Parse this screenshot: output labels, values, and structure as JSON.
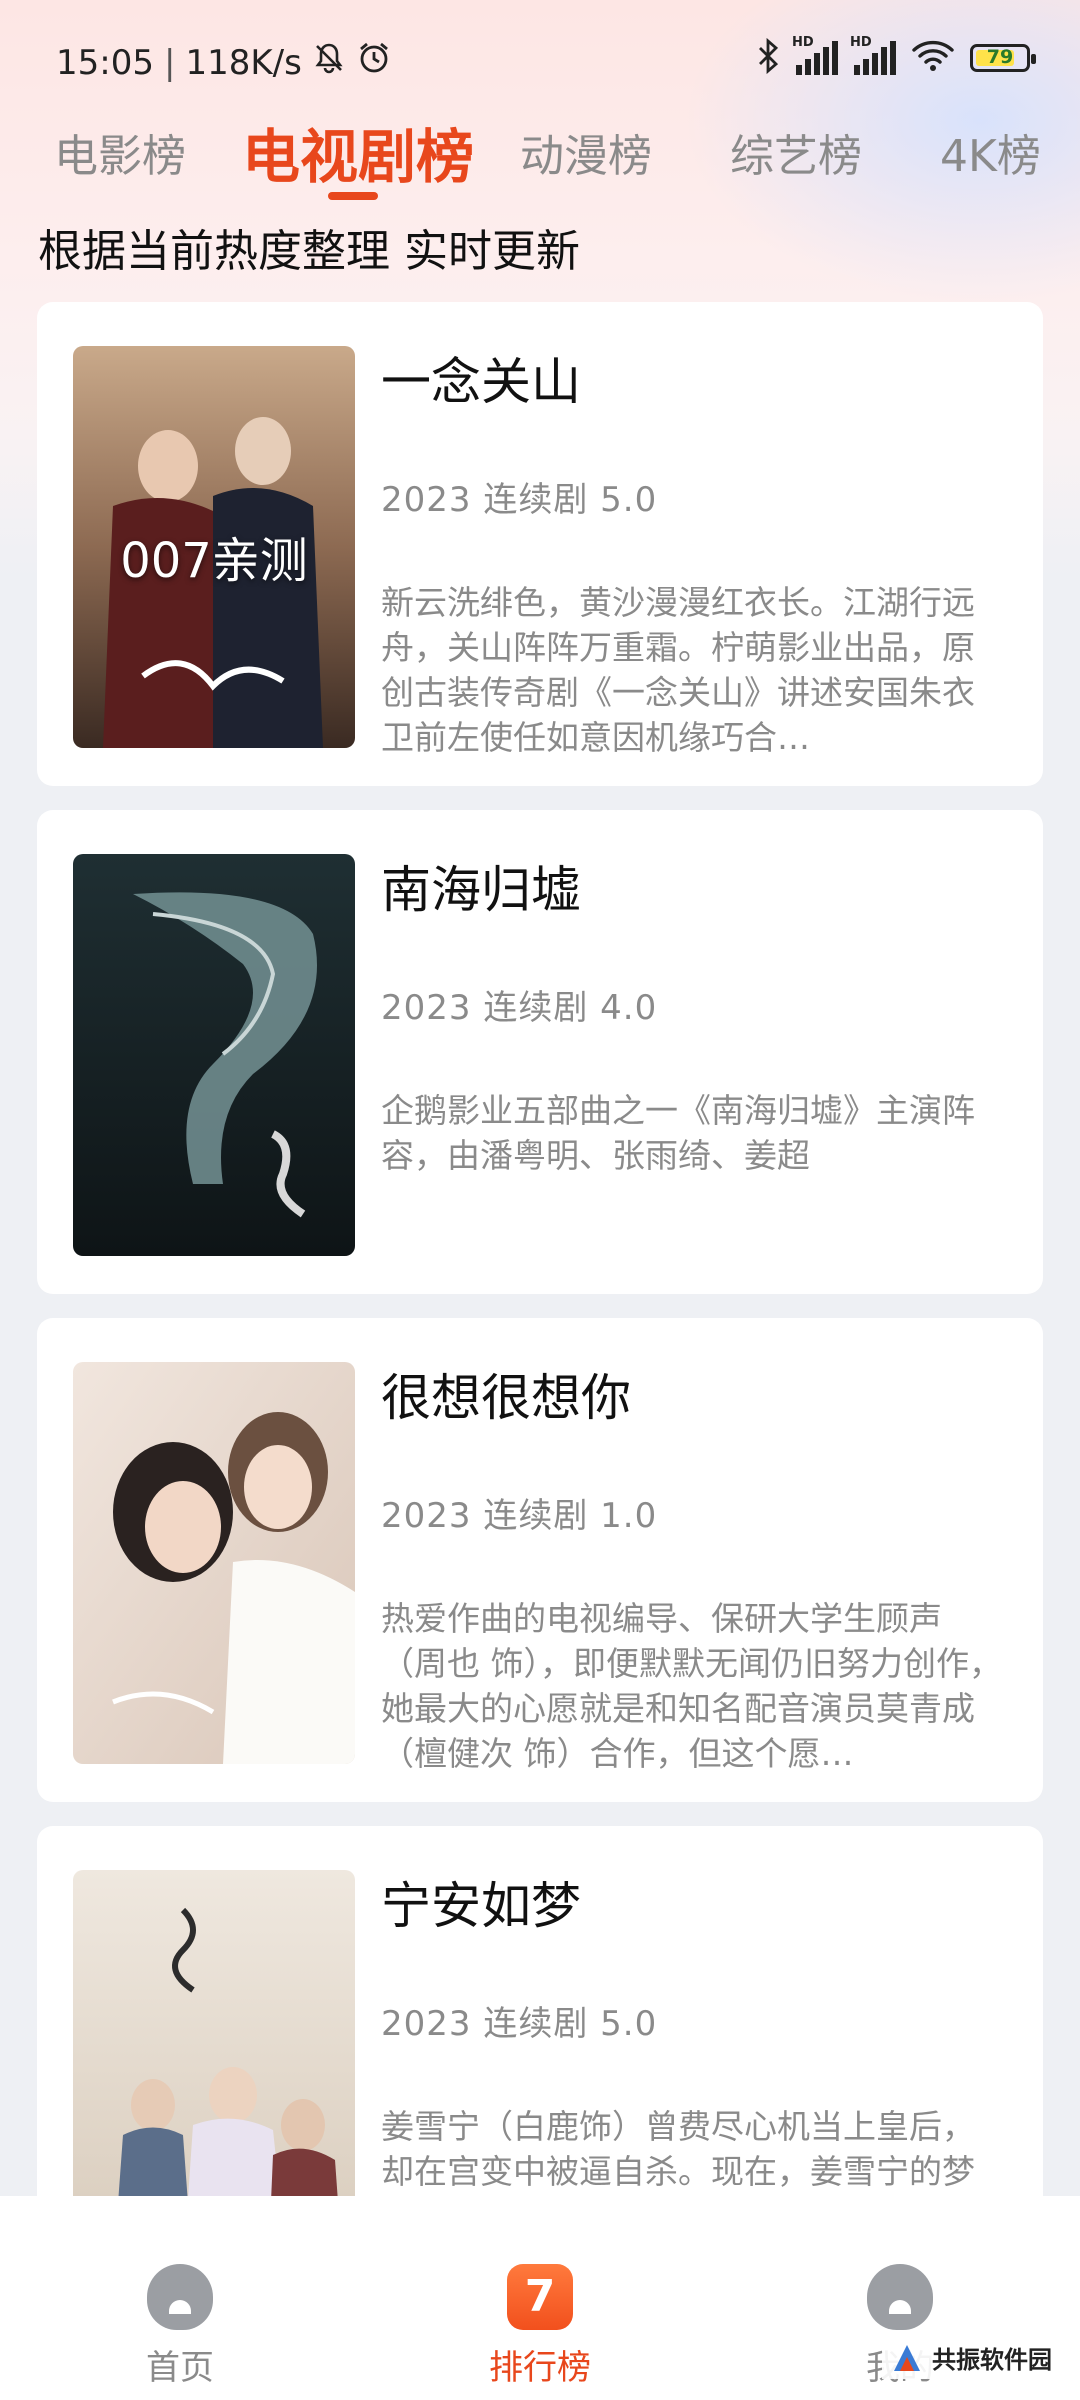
{
  "status_bar": {
    "time": "15:05",
    "separator": "|",
    "speed": "118K/s",
    "battery": "79",
    "signal_label": "HD"
  },
  "tabs": [
    {
      "label": "电影榜",
      "active": false
    },
    {
      "label": "电视剧榜",
      "active": true
    },
    {
      "label": "动漫榜",
      "active": false
    },
    {
      "label": "综艺榜",
      "active": false
    },
    {
      "label": "4K榜",
      "active": false
    }
  ],
  "subtitle": "根据当前热度整理 实时更新",
  "items": [
    {
      "title": "一念关山",
      "meta": "2023  连续剧  5.0",
      "description": "新云洗绯色，黄沙漫漫红衣长。江湖行远舟，关山阵阵万重霜。柠萌影业出品，原创古装传奇剧《一念关山》讲述安国朱衣卫前左使任如意因机缘巧合…",
      "poster_overlay": "007亲测"
    },
    {
      "title": "南海归墟",
      "meta": "2023  连续剧  4.0",
      "description": "企鹅影业五部曲之一《南海归墟》主演阵容，由潘粤明、张雨绮、姜超"
    },
    {
      "title": "很想很想你",
      "meta": "2023  连续剧  1.0",
      "description": "热爱作曲的电视编导、保研大学生顾声（周也 饰），即便默默无闻仍旧努力创作，她最大的心愿就是和知名配音演员莫青成（檀健次 饰）合作，但这个愿…"
    },
    {
      "title": "宁安如梦",
      "meta": "2023  连续剧  5.0",
      "description": "姜雪宁（白鹿饰）曾费尽心机当上皇后，却在宫变中被逼自杀。现在，姜雪宁的梦想就是远离权力，主宰自己的人"
    }
  ],
  "bottom_nav": [
    {
      "label": "首页",
      "icon": "home-ghost-icon",
      "active": false
    },
    {
      "label": "排行榜",
      "icon": "rank-7-icon",
      "active": true
    },
    {
      "label": "我的",
      "icon": "profile-ghost-icon",
      "active": false
    }
  ],
  "rank_icon_glyph": "7",
  "watermark": "共振软件园",
  "colors": {
    "accent": "#e8471c",
    "muted_text": "#8a8a8a",
    "card_bg": "#ffffff",
    "page_bg": "#eef0f4"
  }
}
